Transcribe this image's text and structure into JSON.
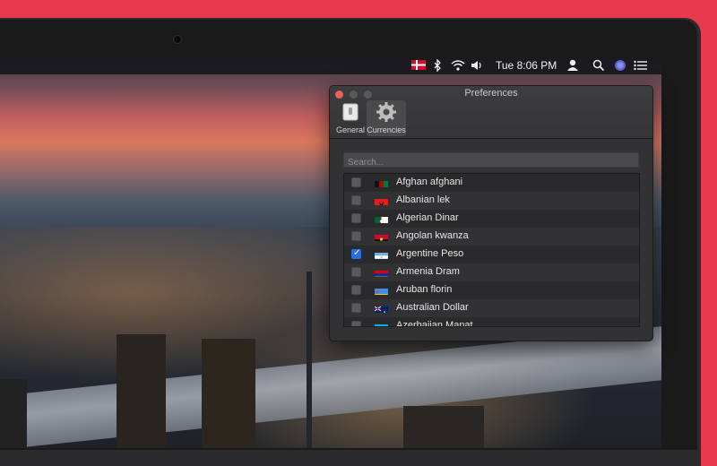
{
  "menubar": {
    "clock": "Tue 8:06 PM",
    "icons": [
      "danish-flag-icon",
      "bluetooth-icon",
      "wifi-icon",
      "volume-icon",
      "user-icon",
      "search-icon",
      "siri-icon",
      "list-icon"
    ]
  },
  "window": {
    "title": "Preferences",
    "toolbar": [
      {
        "label": "General",
        "icon": "switch-icon",
        "selected": false
      },
      {
        "label": "Currencies",
        "icon": "gear-icon",
        "selected": true
      }
    ],
    "search_placeholder": "Search..."
  },
  "currencies": [
    {
      "name": "Afghan afghani",
      "checked": false,
      "flag": "af"
    },
    {
      "name": "Albanian lek",
      "checked": false,
      "flag": "al"
    },
    {
      "name": "Algerian Dinar",
      "checked": false,
      "flag": "dz"
    },
    {
      "name": "Angolan kwanza",
      "checked": false,
      "flag": "ao"
    },
    {
      "name": "Argentine Peso",
      "checked": true,
      "flag": "ar"
    },
    {
      "name": "Armenia Dram",
      "checked": false,
      "flag": "am"
    },
    {
      "name": "Aruban florin",
      "checked": false,
      "flag": "aw"
    },
    {
      "name": "Australian Dollar",
      "checked": false,
      "flag": "au"
    },
    {
      "name": "Azerbaijan Manat",
      "checked": false,
      "flag": "az"
    }
  ],
  "colors": {
    "accent": "#2a6fe0",
    "background": "#e8394f"
  }
}
